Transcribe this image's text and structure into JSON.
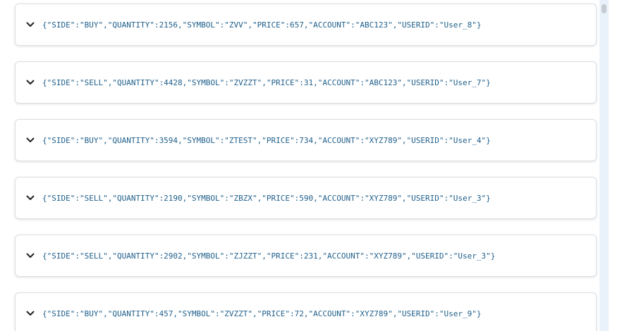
{
  "messages": [
    {
      "text": "{\"SIDE\":\"BUY\",\"QUANTITY\":2156,\"SYMBOL\":\"ZVV\",\"PRICE\":657,\"ACCOUNT\":\"ABC123\",\"USERID\":\"User_8\"}",
      "icon": "chevron-down-icon"
    },
    {
      "text": "{\"SIDE\":\"SELL\",\"QUANTITY\":4428,\"SYMBOL\":\"ZVZZT\",\"PRICE\":31,\"ACCOUNT\":\"ABC123\",\"USERID\":\"User_7\"}",
      "icon": "chevron-down-icon"
    },
    {
      "text": "{\"SIDE\":\"BUY\",\"QUANTITY\":3594,\"SYMBOL\":\"ZTEST\",\"PRICE\":734,\"ACCOUNT\":\"XYZ789\",\"USERID\":\"User_4\"}",
      "icon": "chevron-down-icon"
    },
    {
      "text": "{\"SIDE\":\"SELL\",\"QUANTITY\":2190,\"SYMBOL\":\"ZBZX\",\"PRICE\":590,\"ACCOUNT\":\"XYZ789\",\"USERID\":\"User_3\"}",
      "icon": "chevron-down-icon"
    },
    {
      "text": "{\"SIDE\":\"SELL\",\"QUANTITY\":2902,\"SYMBOL\":\"ZJZZT\",\"PRICE\":231,\"ACCOUNT\":\"XYZ789\",\"USERID\":\"User_3\"}",
      "icon": "chevron-down-icon"
    },
    {
      "text": "{\"SIDE\":\"BUY\",\"QUANTITY\":457,\"SYMBOL\":\"ZVZZT\",\"PRICE\":72,\"ACCOUNT\":\"XYZ789\",\"USERID\":\"User_9\"}",
      "icon": "chevron-down-icon"
    }
  ],
  "colors": {
    "message_text": "#1f5f8b",
    "card_border": "#dcdfe3",
    "scroll_track": "#e9f2fa",
    "scroll_thumb": "#c6ccd2"
  }
}
